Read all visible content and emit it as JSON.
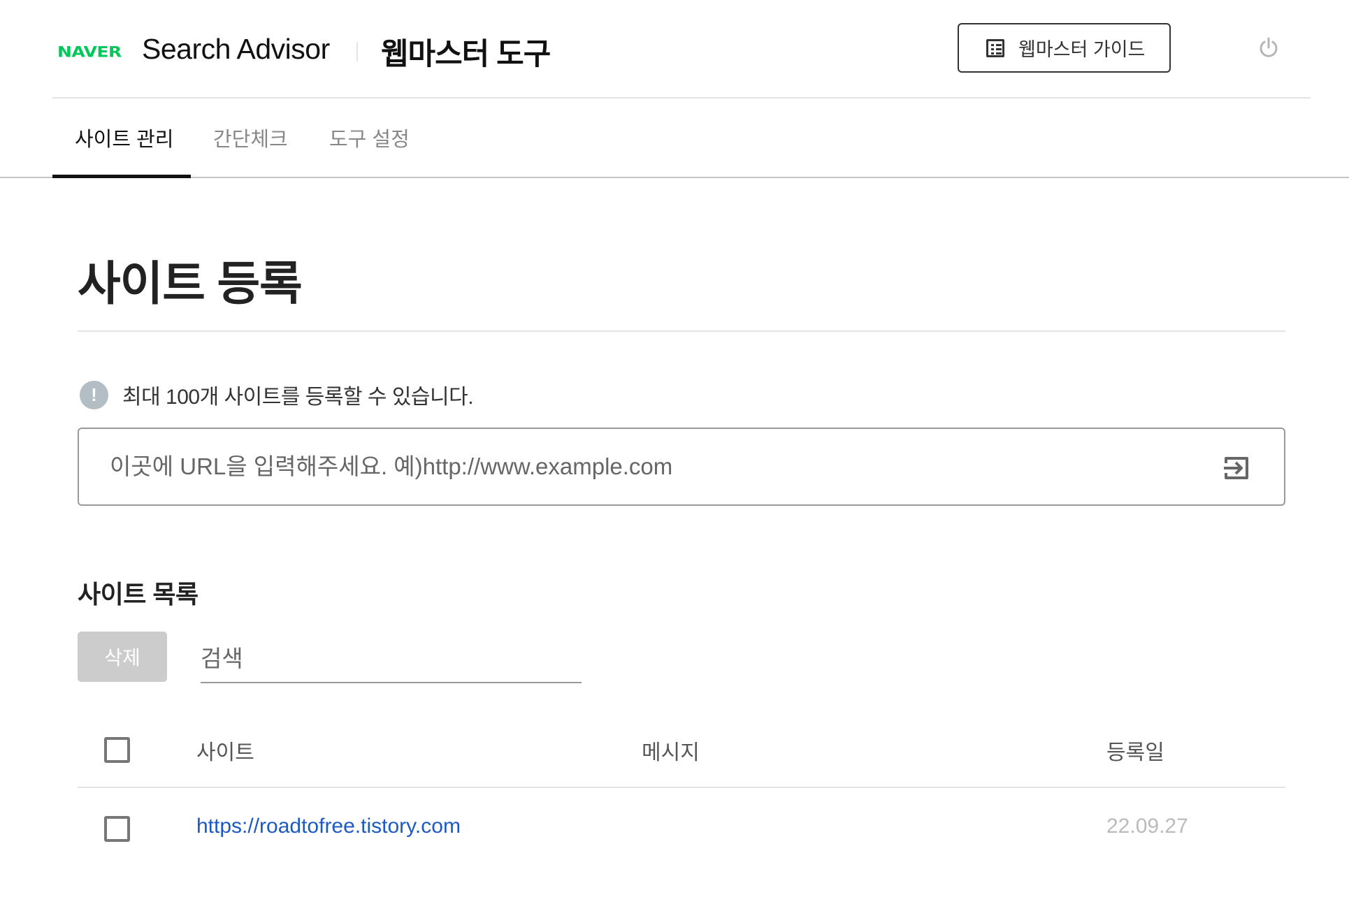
{
  "header": {
    "logo": "NAVER",
    "brand": "Search Advisor",
    "tool_title": "웹마스터 도구",
    "guide_button": "웹마스터 가이드",
    "guide_icon": "list-document-icon",
    "logout_icon": "power-icon",
    "brand_color": "#03c75a"
  },
  "tabs": [
    {
      "label": "사이트 관리",
      "active": true
    },
    {
      "label": "간단체크",
      "active": false
    },
    {
      "label": "도구 설정",
      "active": false
    }
  ],
  "main": {
    "title": "사이트 등록",
    "notice": "최대 100개 사이트를 등록할 수 있습니다.",
    "notice_icon": "exclamation-icon",
    "url_input": {
      "value": "",
      "placeholder": "이곳에 URL을 입력해주세요. 예)http://www.example.com",
      "submit_icon": "enter-arrow-icon"
    }
  },
  "site_list": {
    "title": "사이트 목록",
    "delete_button": "삭제",
    "search": {
      "value": "",
      "placeholder": "검색"
    },
    "columns": [
      "사이트",
      "메시지",
      "등록일"
    ],
    "rows": [
      {
        "site": "https://roadtofree.tistory.com",
        "message": "",
        "date": "22.09.27",
        "checked": false
      }
    ],
    "link_color": "#1b5ac7"
  }
}
